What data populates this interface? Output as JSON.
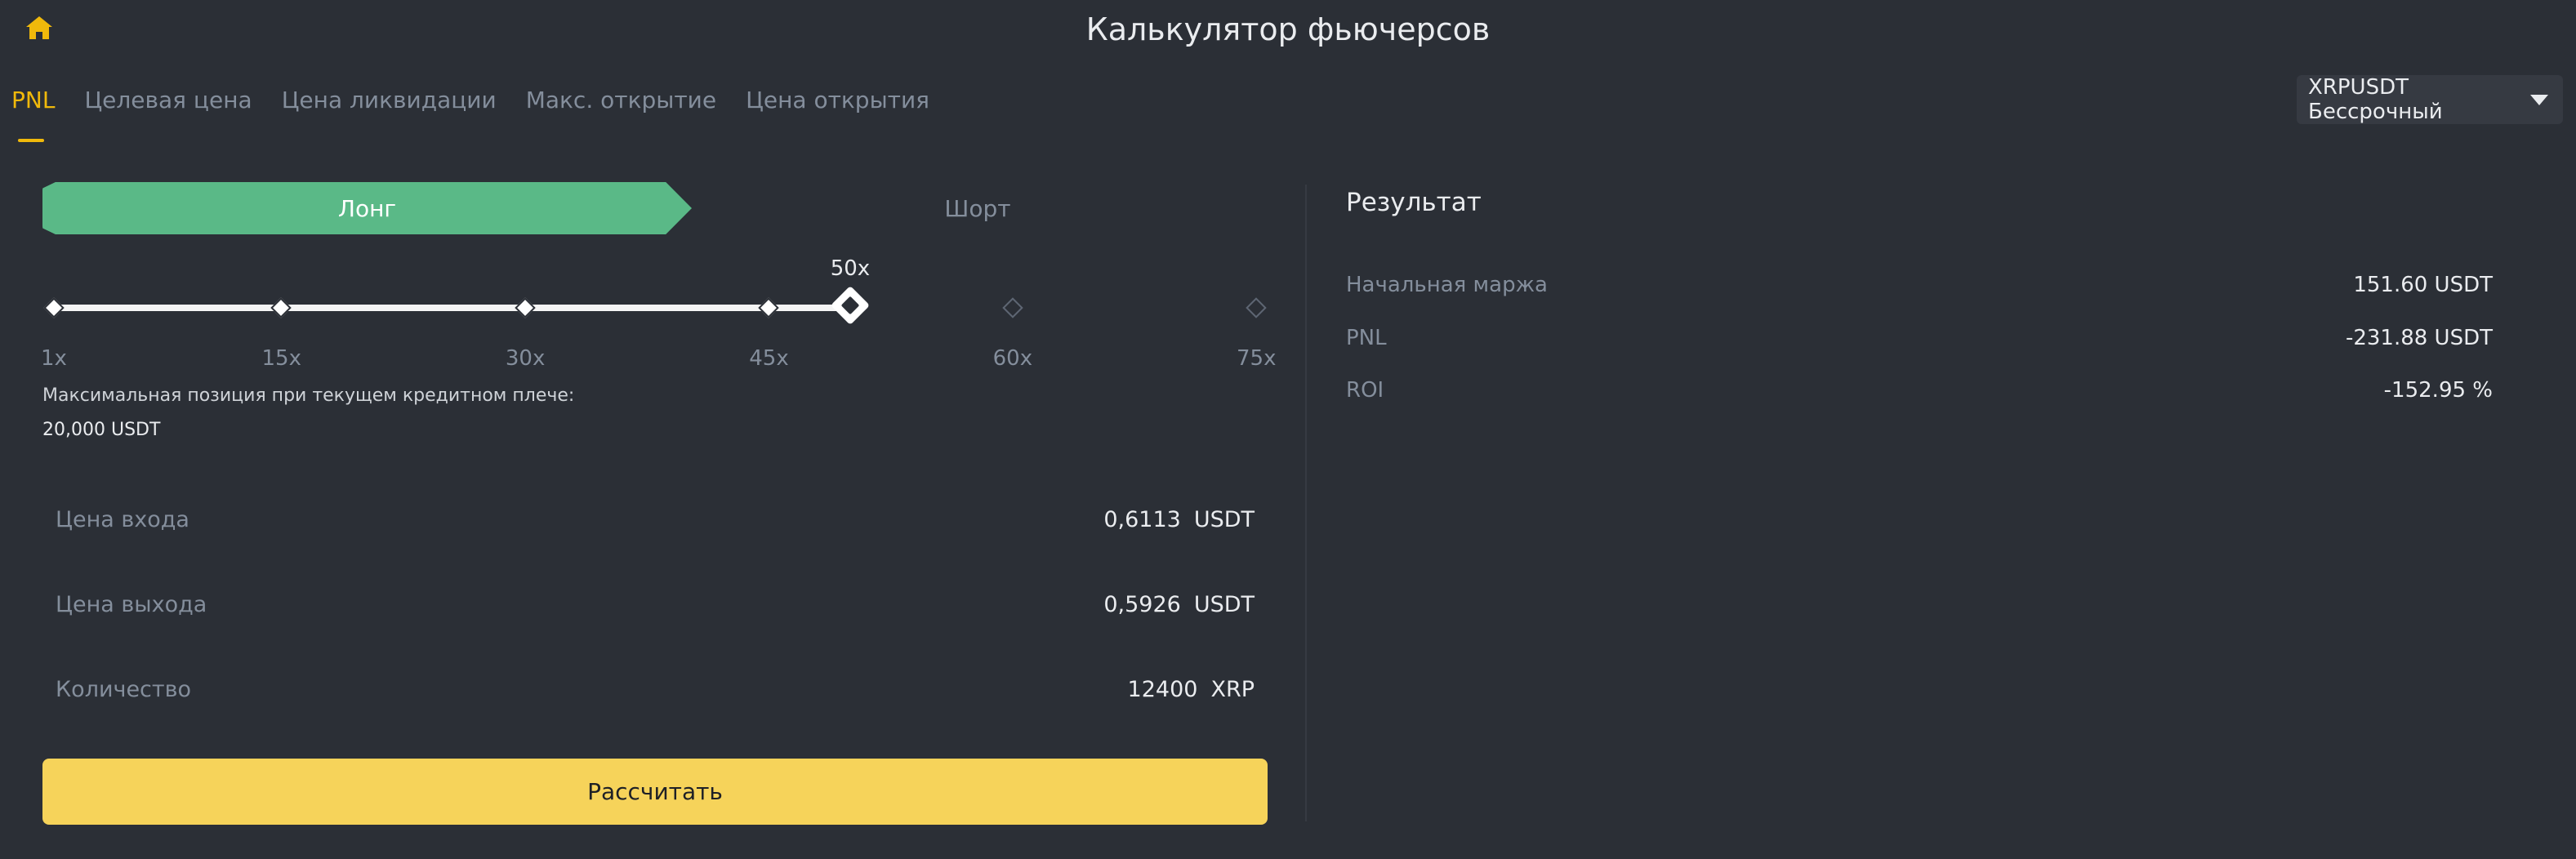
{
  "header": {
    "title": "Калькулятор фьючерсов",
    "home_icon": "home-icon"
  },
  "colors": {
    "accent": "#f0b90b",
    "long": "#5ab987",
    "calculate_button": "#f6d35a",
    "background": "#2b2f36"
  },
  "tabs": [
    {
      "label": "PNL",
      "active": true
    },
    {
      "label": "Целевая цена",
      "active": false
    },
    {
      "label": "Цена ликвидации",
      "active": false
    },
    {
      "label": "Макс. открытие",
      "active": false
    },
    {
      "label": "Цена открытия",
      "active": false
    }
  ],
  "symbol_select": {
    "value": "XRPUSDT Бессрочный"
  },
  "side": {
    "long_label": "Лонг",
    "short_label": "Шорт",
    "selected": "long"
  },
  "leverage": {
    "current_label": "50x",
    "current": 50,
    "min": 1,
    "max": 75,
    "ticks": [
      "1x",
      "15x",
      "30x",
      "45x",
      "60x",
      "75x"
    ]
  },
  "max_position": {
    "label": "Максимальная позиция при текущем кредитном плече:",
    "value": "20,000 USDT"
  },
  "inputs": {
    "entry_price": {
      "label": "Цена входа",
      "value": "0,6113",
      "unit": "USDT"
    },
    "exit_price": {
      "label": "Цена выхода",
      "value": "0,5926",
      "unit": "USDT"
    },
    "quantity": {
      "label": "Количество",
      "value": "12400",
      "unit": "XRP"
    }
  },
  "calculate_label": "Рассчитать",
  "result": {
    "title": "Результат",
    "rows": [
      {
        "label": "Начальная маржа",
        "value": "151.60 USDT"
      },
      {
        "label": "PNL",
        "value": "-231.88 USDT"
      },
      {
        "label": "ROI",
        "value": "-152.95 %"
      }
    ]
  }
}
